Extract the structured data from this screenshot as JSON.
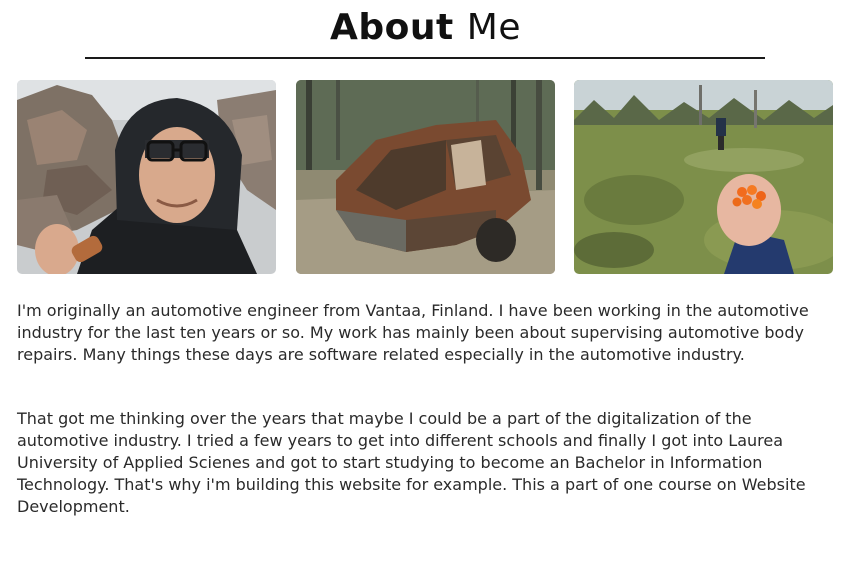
{
  "page": {
    "title_bold": "About",
    "title_light": "Me"
  },
  "photos": [
    {
      "alt": "Man in hooded rain jacket with glasses outdoors next to stone pile"
    },
    {
      "alt": "Rusted abandoned car wreck in forest"
    },
    {
      "alt": "Hand holding orange cloudberries in a bog"
    }
  ],
  "content": {
    "paragraph_1": "I'm originally an automotive engineer from Vantaa, Finland. I have been working in the automotive industry for the last ten years or so. My work has mainly been about supervising automotive body repairs. Many things these days are software related especially in the automotive industry.",
    "paragraph_2": "That got me thinking over the years that maybe I could be a part of the digitalization of the automotive industry. I tried a few years to get into different schools and finally I got into Laurea University of Applied Scienes and got to start studying to become an Bachelor in Information Technology. That's why i'm building this website for example. This a part of one course on Website Development."
  }
}
